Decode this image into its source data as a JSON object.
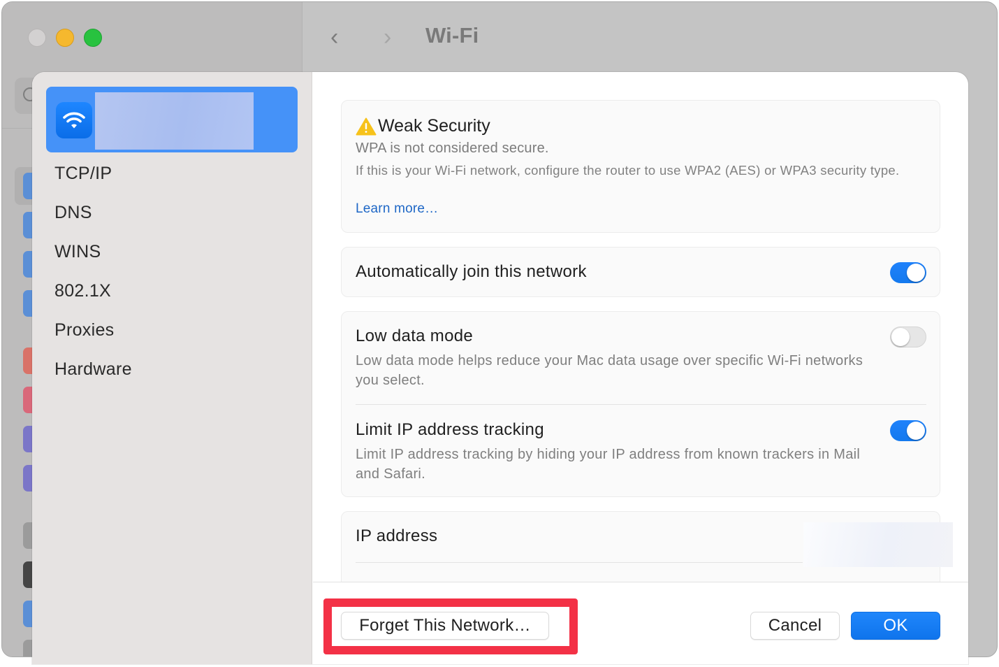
{
  "window": {
    "title": "Wi-Fi",
    "traffic_lights": [
      "close",
      "minimize",
      "maximize"
    ]
  },
  "colors": {
    "accent": "#1479ee",
    "selection": "#4592f8",
    "link": "#1e67c6",
    "warning": "#f7c21a",
    "highlight": "#f33146"
  },
  "sheet": {
    "network_item": {
      "icon": "wifi-icon",
      "name": ""
    },
    "sidebar_items": [
      {
        "label": "TCP/IP"
      },
      {
        "label": "DNS"
      },
      {
        "label": "WINS"
      },
      {
        "label": "802.1X"
      },
      {
        "label": "Proxies"
      },
      {
        "label": "Hardware"
      }
    ],
    "warning": {
      "icon": "warning-icon",
      "title": "Weak Security",
      "subtitle": "WPA is not considered secure.",
      "description": "If this is your Wi-Fi network, configure the router to use WPA2 (AES) or WPA3 security type.",
      "link": "Learn more…"
    },
    "settings": {
      "auto_join": {
        "label": "Automatically join this network",
        "enabled": true
      },
      "low_data_mode": {
        "label": "Low data mode",
        "description": "Low data mode helps reduce your Mac data usage over specific Wi-Fi networks you select.",
        "enabled": false
      },
      "limit_ip_tracking": {
        "label": "Limit IP address tracking",
        "description": "Limit IP address tracking by hiding your IP address from known trackers in Mail and Safari.",
        "enabled": true
      },
      "ip_address": {
        "label": "IP address",
        "value": ""
      }
    },
    "footer": {
      "forget_label": "Forget This Network…",
      "cancel_label": "Cancel",
      "ok_label": "OK"
    }
  }
}
